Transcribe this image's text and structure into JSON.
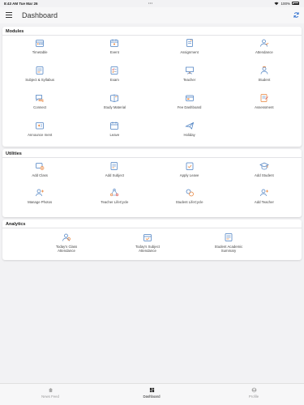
{
  "status_bar": {
    "time": "8:43 AM  Tue Mar 26",
    "dots": "•••",
    "battery": "100%"
  },
  "header": {
    "title": "Dashboard"
  },
  "modules": {
    "title": "Modules",
    "items": [
      {
        "label": "Timetable",
        "icon": "timetable-icon"
      },
      {
        "label": "Event",
        "icon": "event-icon"
      },
      {
        "label": "Assignment",
        "icon": "assignment-icon"
      },
      {
        "label": "Attendance",
        "icon": "attendance-icon"
      },
      {
        "label": "Subject & Syllabus",
        "icon": "syllabus-icon"
      },
      {
        "label": "Exam",
        "icon": "exam-icon"
      },
      {
        "label": "Teacher",
        "icon": "teacher-icon"
      },
      {
        "label": "Student",
        "icon": "student-icon"
      },
      {
        "label": "Connect",
        "icon": "connect-icon"
      },
      {
        "label": "Study Material",
        "icon": "study-material-icon"
      },
      {
        "label": "Fee Dashboard",
        "icon": "fee-icon"
      },
      {
        "label": "Assessment",
        "icon": "assessment-icon"
      },
      {
        "label": "Announce ment",
        "icon": "announcement-icon"
      },
      {
        "label": "Leave",
        "icon": "leave-icon"
      },
      {
        "label": "Holiday",
        "icon": "holiday-icon"
      }
    ]
  },
  "utilities": {
    "title": "Utilities",
    "items": [
      {
        "label": "Add Class",
        "icon": "add-class-icon"
      },
      {
        "label": "Add Subject",
        "icon": "add-subject-icon"
      },
      {
        "label": "Apply Leave",
        "icon": "apply-leave-icon"
      },
      {
        "label": "Add Student",
        "icon": "add-student-icon"
      },
      {
        "label": "Manage Photos",
        "icon": "manage-photos-icon"
      },
      {
        "label": "Teacher LifeCycle",
        "icon": "teacher-lifecycle-icon"
      },
      {
        "label": "Student LifeCycle",
        "icon": "student-lifecycle-icon"
      },
      {
        "label": "Add Teacher",
        "icon": "add-teacher-icon"
      }
    ]
  },
  "analytics": {
    "title": "Analytics",
    "items": [
      {
        "label": "Today's Class Attendance",
        "icon": "class-attendance-icon"
      },
      {
        "label": "Today's Subject Attendance",
        "icon": "subject-attendance-icon"
      },
      {
        "label": "Student Academic Summary",
        "icon": "academic-summary-icon"
      }
    ]
  },
  "tabbar": {
    "news": "News Feed",
    "dashboard": "Dashboard",
    "profile": "Profile"
  },
  "colors": {
    "icon_blue": "#4a7fc1",
    "icon_orange": "#e8833a",
    "icon_red": "#d9534f"
  }
}
